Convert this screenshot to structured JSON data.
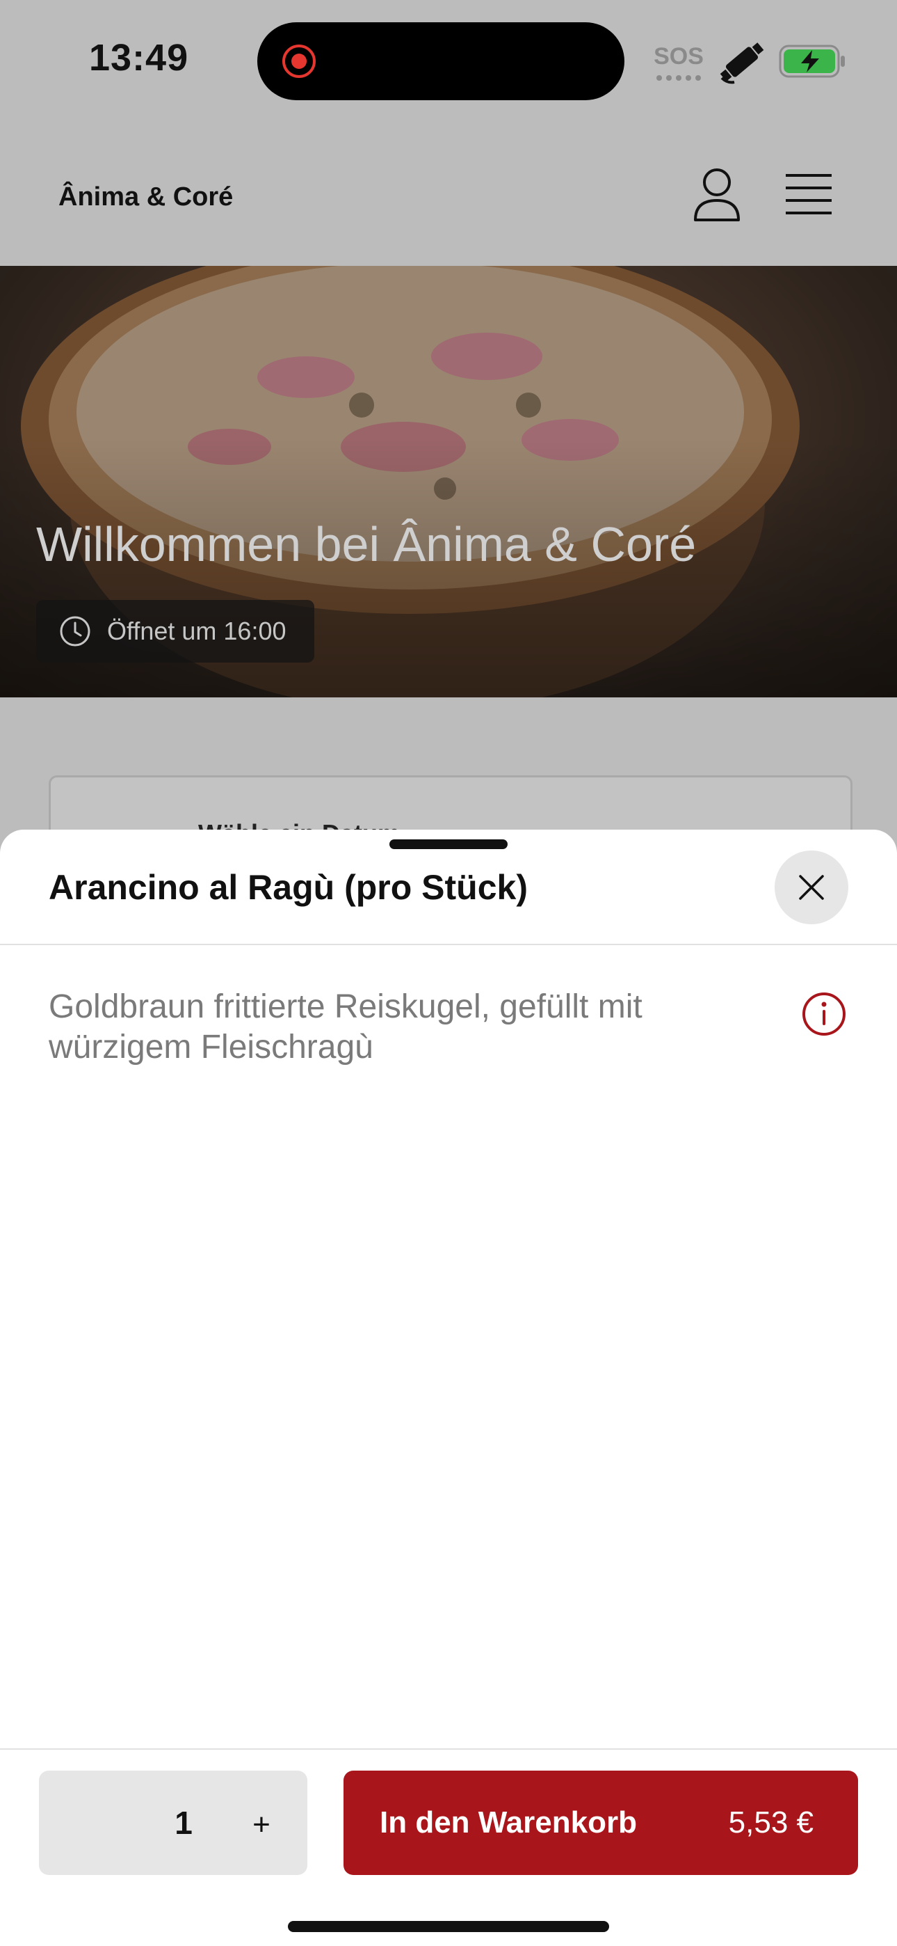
{
  "status_bar": {
    "time": "13:49",
    "sos_label": "SOS",
    "icons": [
      "screen-recording-icon",
      "satellite-icon",
      "battery-charging-icon"
    ],
    "recording_color": "#e5362f",
    "battery_color": "#3bb54a"
  },
  "header": {
    "brand": "Ânima & Coré",
    "icons": [
      "user-icon",
      "menu-icon"
    ]
  },
  "hero": {
    "title": "Willkommen bei Ânima & Coré",
    "hours": "Öffnet um 16:00",
    "hours_icon": "clock-icon"
  },
  "date_picker": {
    "label": "Wähle ein Datum"
  },
  "product_sheet": {
    "title": "Arancino al Ragù (pro Stück)",
    "close_icon": "close-icon",
    "description": "Goldbraun frittierte Reiskugel, gefüllt mit würzigem Fleischragù",
    "info_icon": "info-icon",
    "quantity": "1",
    "plus_label": "+",
    "add_to_cart_label": "In den Warenkorb",
    "price": "5,53 €",
    "accent_color": "#a8161c"
  }
}
